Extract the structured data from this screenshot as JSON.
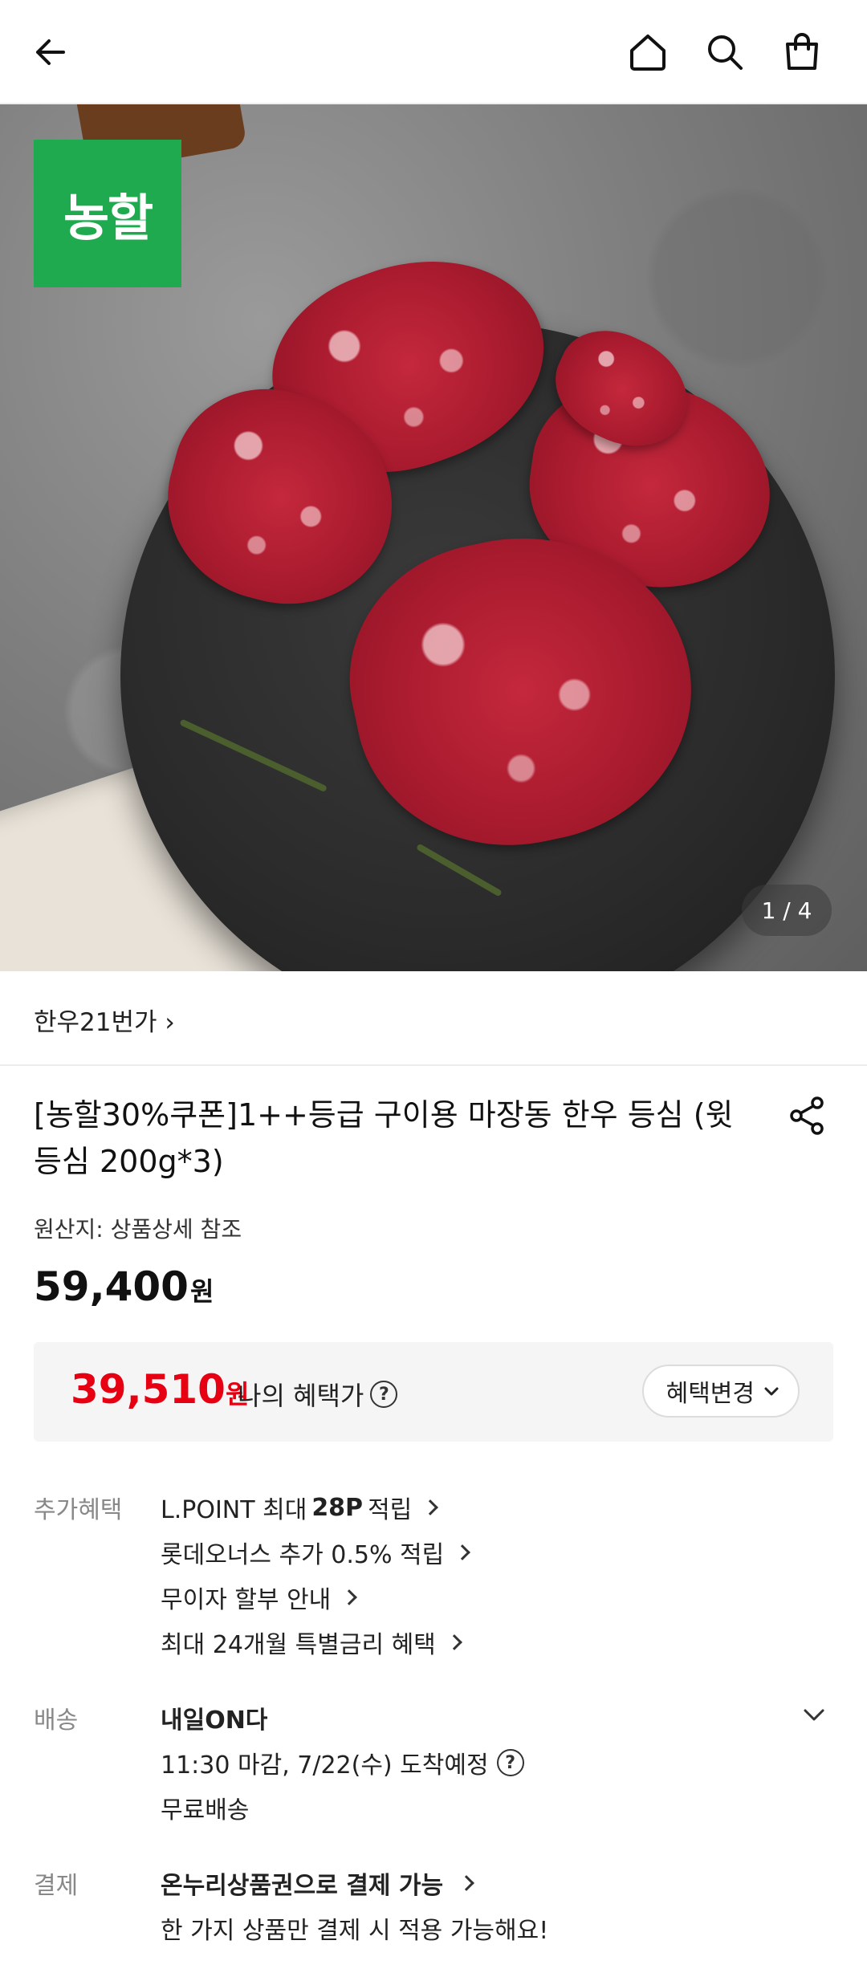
{
  "header": {
    "back_icon": "arrow-left-icon",
    "home_icon": "home-icon",
    "search_icon": "search-icon",
    "cart_icon": "shopping-bag-icon"
  },
  "hero": {
    "brand_logo_text": "농할",
    "pager": "1 / 4",
    "brand_color": "#1faa4f"
  },
  "store": {
    "name": "한우21번가 ›"
  },
  "product": {
    "title": "[농할30%쿠폰]1++등급 구이용 마장동 한우 등심 (윗등심 200g*3)",
    "origin": "원산지: 상품상세 참조",
    "price": "59,400",
    "price_unit": "원"
  },
  "benefit_box": {
    "price": "39,510",
    "price_unit": "원",
    "label": "나의 혜택가",
    "change_button": "혜택변경",
    "accent_color": "#e60012"
  },
  "extra_benefits": {
    "label": "추가혜택",
    "lines": [
      {
        "pre": "L.POINT 최대",
        "bold": "28P",
        "post": "적립"
      },
      {
        "pre": "롯데오너스 추가 0.5% 적립",
        "bold": "",
        "post": ""
      },
      {
        "pre": "무이자 할부 안내",
        "bold": "",
        "post": ""
      },
      {
        "pre": "최대 24개월 특별금리 혜택",
        "bold": "",
        "post": ""
      }
    ]
  },
  "delivery": {
    "label": "배송",
    "title": "내일ON다",
    "info": "11:30 마감, 7/22(수) 도착예정",
    "fee": "무료배송"
  },
  "payment": {
    "label": "결제",
    "title": "온누리상품권으로 결제 가능",
    "note": "한 가지 상품만 결제 시 적용 가능해요!"
  }
}
